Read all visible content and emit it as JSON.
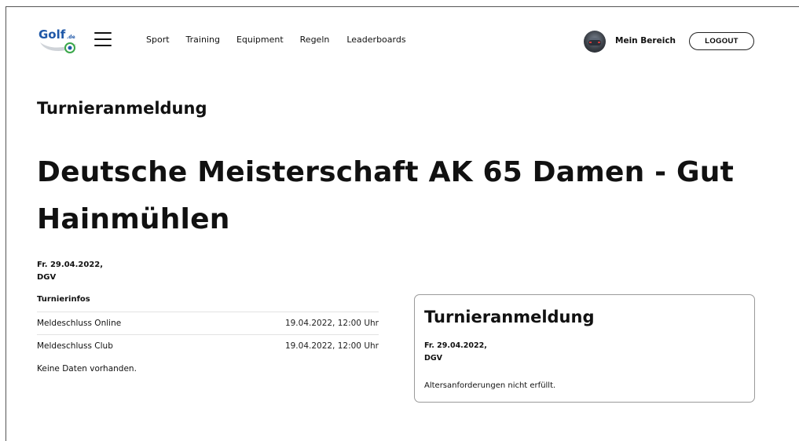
{
  "header": {
    "logo_text": "Golf",
    "logo_suffix": ".de",
    "nav": [
      "Sport",
      "Training",
      "Equipment",
      "Regeln",
      "Leaderboards"
    ],
    "account_label": "Mein Bereich",
    "logout_label": "LOGOUT"
  },
  "page": {
    "heading": "Turnieranmeldung",
    "event_title": "Deutsche Meisterschaft AK 65 Damen - Gut Hainmühlen",
    "event_date": "Fr. 29.04.2022,",
    "event_org": "DGV"
  },
  "info": {
    "label": "Turnierinfos",
    "rows": [
      {
        "key": "Meldeschluss Online",
        "value": "19.04.2022, 12:00 Uhr"
      },
      {
        "key": "Meldeschluss Club",
        "value": "19.04.2022, 12:00 Uhr"
      }
    ],
    "empty_text": "Keine Daten vorhanden."
  },
  "registration": {
    "title": "Turnieranmeldung",
    "date": "Fr. 29.04.2022,",
    "org": "DGV",
    "message": "Altersanforderungen nicht erfüllt."
  },
  "colors": {
    "logo_blue": "#1f58a8",
    "logo_green": "#3aa74a",
    "text": "#111111"
  }
}
